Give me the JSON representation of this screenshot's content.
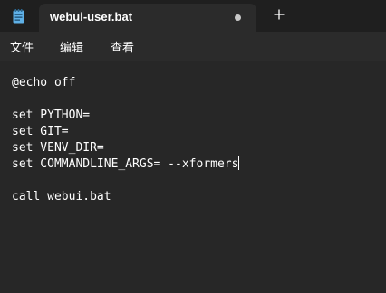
{
  "tab": {
    "title": "webui-user.bat",
    "unsaved_indicator": "modified-dot-icon"
  },
  "icons": {
    "app": "notepad-icon",
    "new_tab": "plus-icon"
  },
  "menu": {
    "file": "文件",
    "edit": "编辑",
    "view": "查看"
  },
  "editor": {
    "lines": [
      "@echo off",
      "",
      "set PYTHON=",
      "set GIT=",
      "set VENV_DIR=",
      "set COMMANDLINE_ARGS= --xformers",
      "",
      "call webui.bat"
    ],
    "caret_line": 6
  },
  "colors": {
    "background": "#272727",
    "titlebar": "#1f1f1f",
    "tab": "#2b2b2b",
    "text": "#ffffff"
  }
}
